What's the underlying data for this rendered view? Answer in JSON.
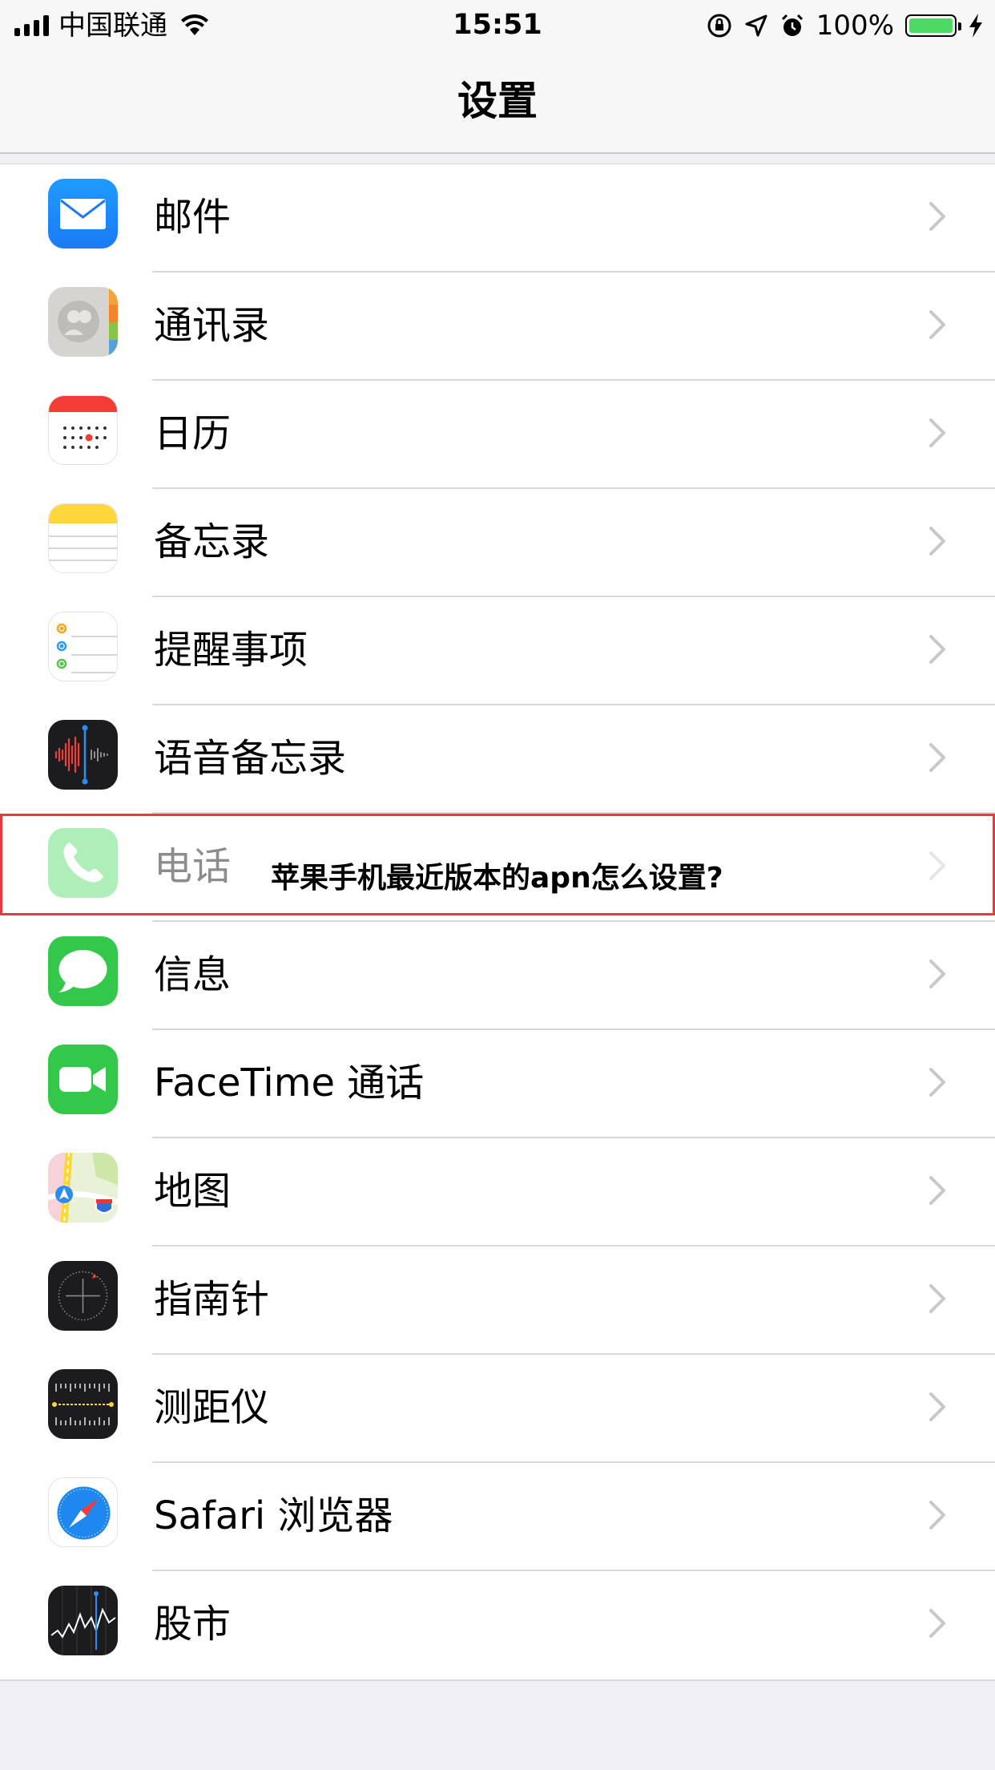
{
  "status_bar": {
    "carrier": "中国联通",
    "time": "15:51",
    "battery": "100%"
  },
  "nav": {
    "title": "设置"
  },
  "rows": [
    {
      "label": "邮件",
      "icon": "mail-icon"
    },
    {
      "label": "通讯录",
      "icon": "contacts-icon"
    },
    {
      "label": "日历",
      "icon": "calendar-icon"
    },
    {
      "label": "备忘录",
      "icon": "notes-icon"
    },
    {
      "label": "提醒事项",
      "icon": "reminders-icon"
    },
    {
      "label": "语音备忘录",
      "icon": "voice-memos-icon"
    },
    {
      "label": "电话",
      "icon": "phone-icon"
    },
    {
      "label": "信息",
      "icon": "messages-icon"
    },
    {
      "label": "FaceTime 通话",
      "icon": "facetime-icon"
    },
    {
      "label": "地图",
      "icon": "maps-icon"
    },
    {
      "label": "指南针",
      "icon": "compass-icon"
    },
    {
      "label": "测距仪",
      "icon": "measure-icon"
    },
    {
      "label": "Safari 浏览器",
      "icon": "safari-icon"
    },
    {
      "label": "股市",
      "icon": "stocks-icon"
    }
  ],
  "overlay": {
    "caption": "苹果手机最近版本的apn怎么设置?"
  },
  "colors": {
    "accent_highlight": "#e23c3c",
    "battery": "#4cd964"
  }
}
